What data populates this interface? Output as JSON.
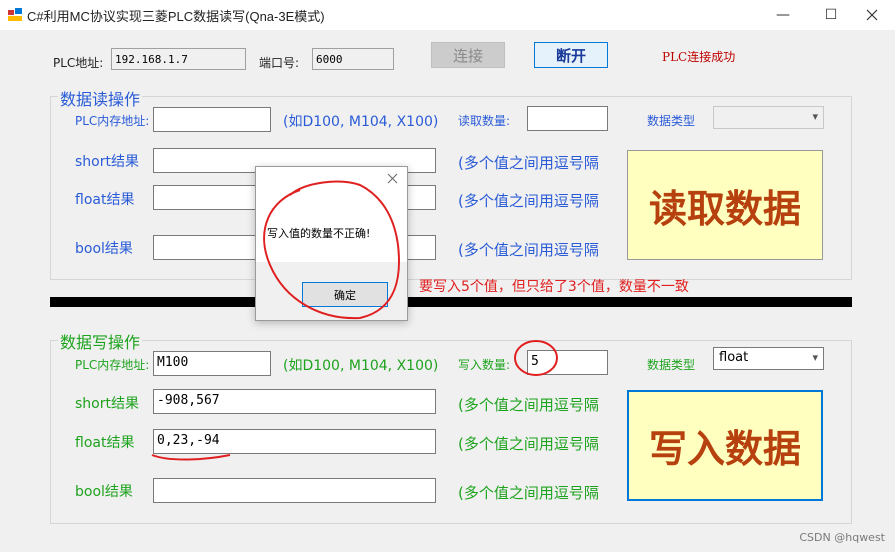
{
  "window": {
    "title": "C#利用MC协议实现三菱PLC数据读写(Qna-3E模式)",
    "minimize": "—",
    "maximize": "☐"
  },
  "connection": {
    "plc_addr_label": "PLC地址:",
    "plc_addr_value": "192.168.1.7",
    "port_label": "端口号:",
    "port_value": "6000",
    "connect_label": "连接",
    "disconnect_label": "断开",
    "status": "PLC连接成功"
  },
  "read": {
    "group_title": "数据读操作",
    "mem_label": "PLC内存地址:",
    "mem_hint": "(如D100, M104, X100)",
    "count_label": "读取数量:",
    "type_label": "数据类型",
    "short_label": "short结果",
    "float_label": "float结果",
    "bool_label": "bool结果",
    "multi_hint": "(多个值之间用逗号隔",
    "button": "读取数据"
  },
  "write": {
    "group_title": "数据写操作",
    "mem_label": "PLC内存地址:",
    "mem_value": "M100",
    "mem_hint": "(如D100, M104, X100)",
    "count_label": "写入数量:",
    "count_value": "5",
    "type_label": "数据类型",
    "type_value": "float",
    "short_label": "short结果",
    "short_value": "-908,567",
    "float_label": "float结果",
    "float_value": "0,23,-94",
    "bool_label": "bool结果",
    "multi_hint": "(多个值之间用逗号隔",
    "button": "写入数据"
  },
  "dialog": {
    "message": "写入值的数量不正确!",
    "ok_label": "确定"
  },
  "annotation": "要写入5个值，但只给了3个值，数量不一致",
  "watermark": "CSDN @hqwest",
  "colors": {
    "read_red": "#b7410e",
    "write_red": "#b7410e",
    "focus_blue": "#0078d7"
  }
}
